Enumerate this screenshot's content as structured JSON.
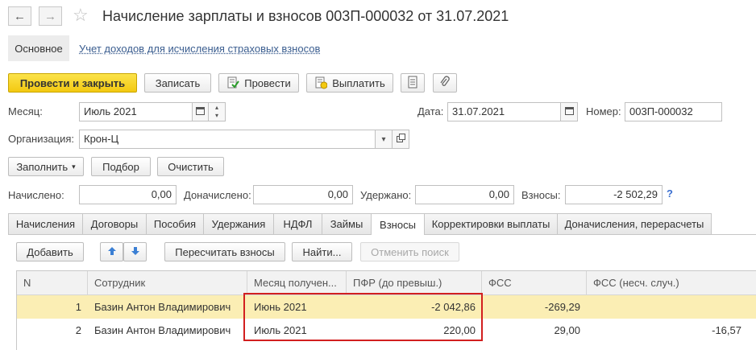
{
  "header": {
    "title": "Начисление зарплаты и взносов 003П-000032 от 31.07.2021",
    "back_icon": "←",
    "forward_icon": "→",
    "star_icon": "☆"
  },
  "sections": {
    "main": "Основное",
    "link": "Учет доходов для исчисления страховых взносов"
  },
  "toolbar": {
    "post_close": "Провести и закрыть",
    "save": "Записать",
    "post": "Провести",
    "pay": "Выплатить"
  },
  "form": {
    "month_label": "Месяц:",
    "month_value": "Июль 2021",
    "date_label": "Дата:",
    "date_value": "31.07.2021",
    "number_label": "Номер:",
    "number_value": "003П-000032",
    "org_label": "Организация:",
    "org_value": "Крон-Ц"
  },
  "actions": {
    "fill": "Заполнить",
    "pick": "Подбор",
    "clear": "Очистить"
  },
  "totals": {
    "accrued_label": "Начислено:",
    "accrued_value": "0,00",
    "extra_label": "Доначислено:",
    "extra_value": "0,00",
    "withheld_label": "Удержано:",
    "withheld_value": "0,00",
    "contrib_label": "Взносы:",
    "contrib_value": "-2 502,29",
    "help": "?"
  },
  "tabs": [
    "Начисления",
    "Договоры",
    "Пособия",
    "Удержания",
    "НДФЛ",
    "Займы",
    "Взносы",
    "Корректировки выплаты",
    "Доначисления, перерасчеты"
  ],
  "active_tab": "Взносы",
  "table_toolbar": {
    "add": "Добавить",
    "recalc": "Пересчитать взносы",
    "find": "Найти...",
    "cancel_search": "Отменить поиск"
  },
  "table": {
    "columns": [
      "N",
      "Сотрудник",
      "Месяц получен...",
      "ПФР (до превыш.)",
      "ФСС",
      "ФСС (несч. случ.)"
    ],
    "rows": [
      [
        "1",
        "Базин Антон Владимирович",
        "Июнь 2021",
        "-2 042,86",
        "-269,29",
        ""
      ],
      [
        "2",
        "Базин Антон Владимирович",
        "Июль 2021",
        "220,00",
        "29,00",
        "-16,57"
      ]
    ]
  },
  "colors": {
    "primary_button": "#f5cf1a",
    "row_highlight": "#fbeeb4",
    "highlight_box": "#d21f1f",
    "link": "#3a5d8f"
  }
}
